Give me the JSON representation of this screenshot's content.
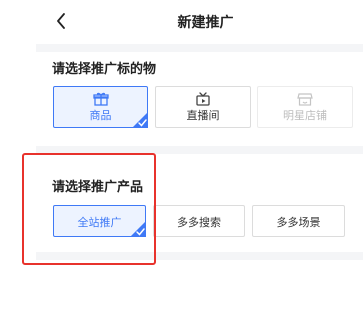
{
  "header": {
    "back_icon": "chevron-left-icon",
    "title": "新建推广"
  },
  "target_section": {
    "title": "请选择推广标的物",
    "options": [
      {
        "label": "商品",
        "icon": "gift-icon",
        "state": "selected"
      },
      {
        "label": "直播间",
        "icon": "tv-icon",
        "state": "normal"
      },
      {
        "label": "明星店铺",
        "icon": "store-icon",
        "state": "disabled"
      }
    ]
  },
  "product_section": {
    "title": "请选择推广产品",
    "options": [
      {
        "label": "全站推广",
        "state": "selected"
      },
      {
        "label": "多多搜索",
        "state": "normal"
      },
      {
        "label": "多多场景",
        "state": "normal"
      }
    ]
  },
  "colors": {
    "accent": "#3f79f6",
    "selected_bg": "#edf3ff",
    "highlight_box": "#e8322c",
    "disabled_text": "#bdbdbd"
  }
}
